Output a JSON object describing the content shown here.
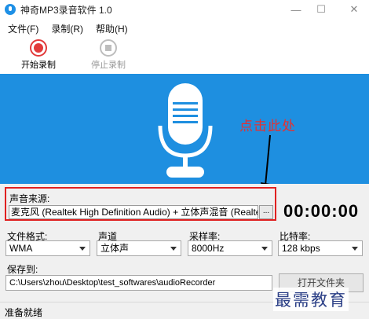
{
  "window": {
    "title": "神奇MP3录音软件 1.0",
    "controls": {
      "minimize": "—",
      "maximize": "☐",
      "close": "✕"
    }
  },
  "menu": {
    "items": [
      "文件(F)",
      "录制(R)",
      "帮助(H)"
    ]
  },
  "toolbar": {
    "start_label": "开始录制",
    "stop_label": "停止录制"
  },
  "callout": {
    "text": "点击此处"
  },
  "source": {
    "label": "声音来源:",
    "value": "麦克风 (Realtek High Definition Audio) + 立体声混音 (Realtek High Definition Audio)",
    "browse_label": "..."
  },
  "timer": {
    "value": "00:00:00"
  },
  "format": {
    "label": "文件格式:",
    "value": "WMA"
  },
  "channel": {
    "label": "声道",
    "value": "立体声"
  },
  "sample_rate": {
    "label": "采样率:",
    "value": "8000Hz"
  },
  "bitrate": {
    "label": "比特率:",
    "value": "128 kbps"
  },
  "save": {
    "label": "保存到:",
    "path": "C:\\Users\\zhou\\Desktop\\test_softwares\\audioRecorder",
    "open_button": "打开文件夹"
  },
  "status": {
    "text": "准备就绪"
  },
  "watermark": {
    "text": "最需教育"
  },
  "colors": {
    "accent_blue": "#1e8fe0",
    "record_red": "#e23b3b",
    "highlight_red": "#e02020"
  }
}
